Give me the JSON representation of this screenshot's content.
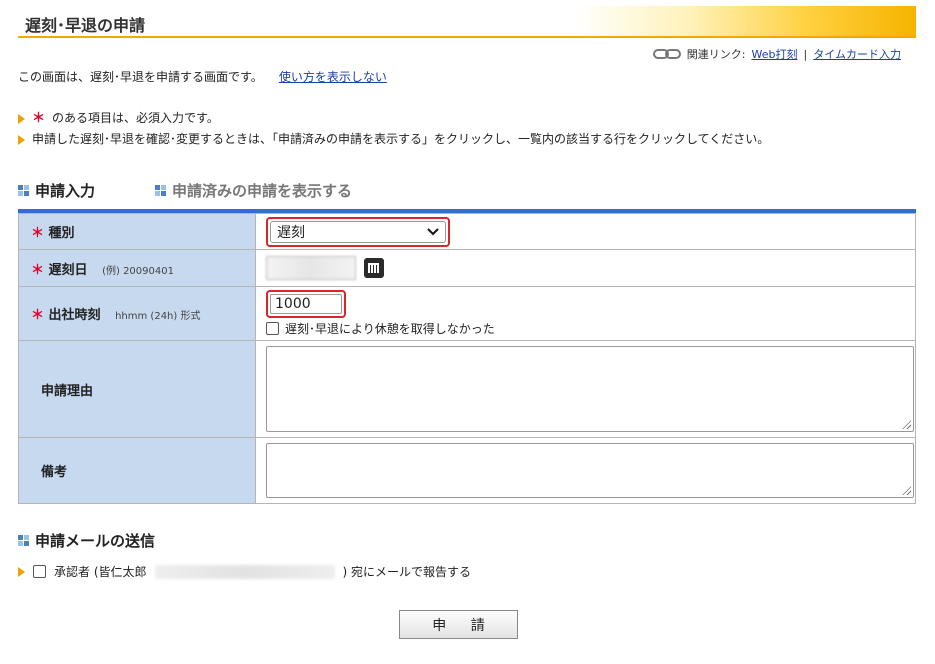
{
  "page": {
    "title": "遅刻･早退の申請",
    "intro": "この画面は、遅刻･早退を申請する画面です。",
    "howto_link": "使い方を表示しない"
  },
  "related": {
    "label": "関連リンク:",
    "link1": "Web打刻",
    "separator": "|",
    "link2": "タイムカード入力"
  },
  "notes": {
    "required_mark": "＊",
    "required_text": "のある項目は、必須入力です。",
    "line2": "申請した遅刻･早退を確認･変更するときは、「申請済みの申請を表示する」をクリックし、一覧内の該当する行をクリックしてください。"
  },
  "tabs": [
    {
      "label": "申請入力"
    },
    {
      "label": "申請済みの申請を表示する"
    }
  ],
  "form": {
    "type": {
      "mark": "＊",
      "label": "種別",
      "value": "遅刻"
    },
    "date": {
      "mark": "＊",
      "label": "遅刻日",
      "hint": "(例) 20090401"
    },
    "time": {
      "mark": "＊",
      "label": "出社時刻",
      "hint": "hhmm (24h) 形式",
      "value": "1000",
      "checkbox_label": "遅刻･早退により休憩を取得しなかった"
    },
    "reason": {
      "label": "申請理由"
    },
    "remarks": {
      "label": "備考"
    }
  },
  "mail": {
    "heading": "申請メールの送信",
    "approver_prefix": "承認者 (皆仁太郎",
    "approver_suffix": ") 宛にメールで報告する"
  },
  "submit_label": "申 請",
  "colors": {
    "accent_blue": "#2f6fce",
    "label_bg": "#c6d9ef",
    "required_red": "#e0002a",
    "highlight_red": "#d8262d"
  }
}
